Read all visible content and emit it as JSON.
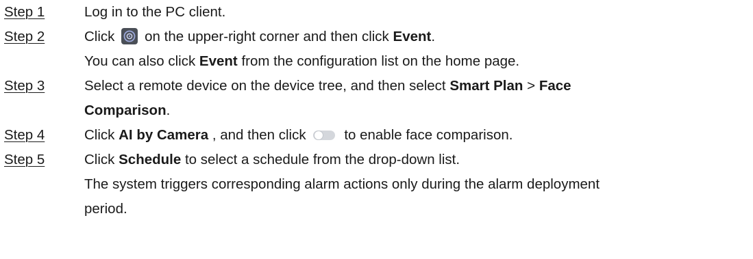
{
  "steps": [
    {
      "label": "Step 1",
      "text": "Log in to the PC client."
    },
    {
      "label": "Step 2",
      "pre": "Click",
      "icon": "gear-icon",
      "mid": "on the upper-right corner and then click",
      "bold": "Event",
      "post": ".",
      "note_pre": "You can also click",
      "note_bold": "Event",
      "note_post": "from the configuration list on the home page."
    },
    {
      "label": "Step 3",
      "pre": "Select a remote device on the device tree, and then select",
      "bold1": "Smart Plan",
      "sep": ">",
      "bold2": "Face",
      "bold3": "Comparison",
      "post": "."
    },
    {
      "label": "Step 4",
      "pre": "Click",
      "bold": "AI by Camera",
      "mid": ", and then click",
      "icon": "toggle-switch-icon",
      "post": "to enable face comparison."
    },
    {
      "label": "Step 5",
      "pre": "Click",
      "bold": "Schedule",
      "post": "to select a schedule from the drop-down list.",
      "note_line1": "The system triggers corresponding alarm actions only during the alarm deployment",
      "note_line2": "period."
    }
  ],
  "colors": {
    "text": "#1a1a1a",
    "gear_icon_bg": "#4a4f57",
    "toggle_off": "#d4d7dc"
  }
}
